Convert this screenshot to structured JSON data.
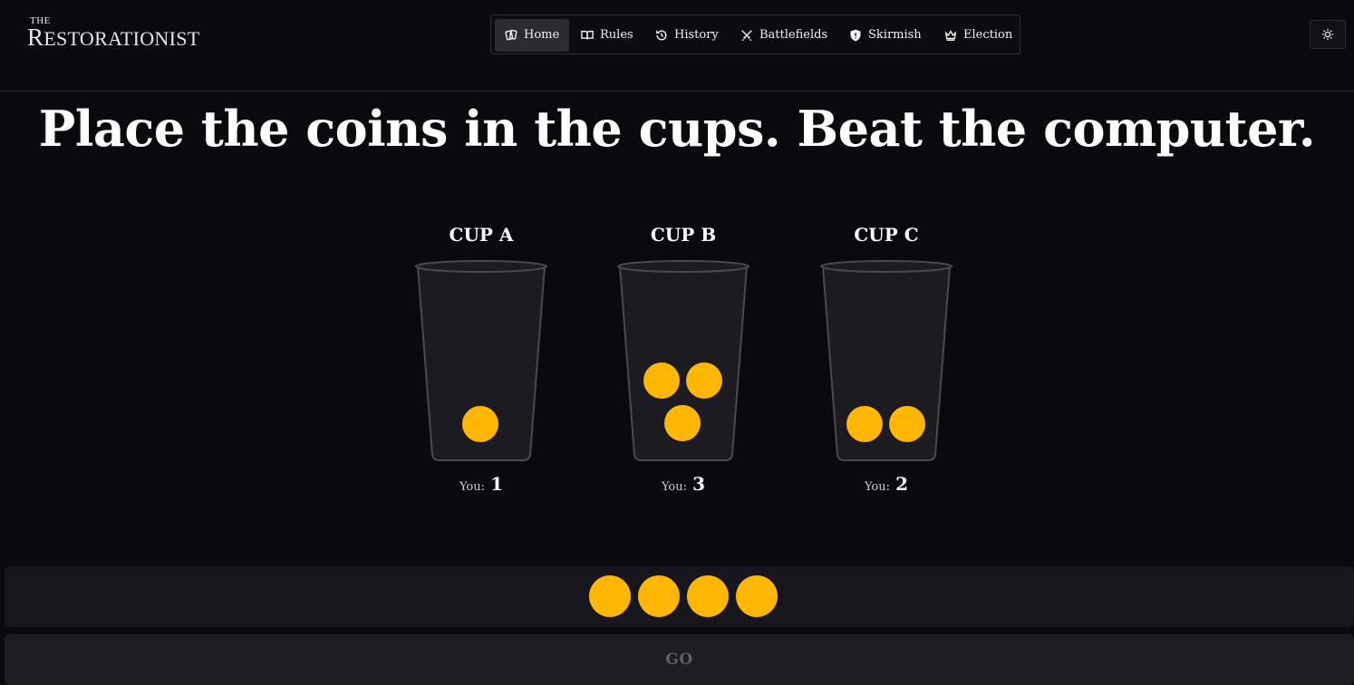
{
  "brand": {
    "the": "THE",
    "first_letter": "R",
    "rest": "ESTORATIONIST"
  },
  "nav": {
    "items": [
      {
        "label": "Home",
        "icon": "cards-icon",
        "active": true
      },
      {
        "label": "Rules",
        "icon": "book-icon"
      },
      {
        "label": "History",
        "icon": "history-icon"
      },
      {
        "label": "Battlefields",
        "icon": "crossed-swords-icon"
      },
      {
        "label": "Skirmish",
        "icon": "shield-icon"
      },
      {
        "label": "Election",
        "icon": "crown-icon"
      }
    ]
  },
  "theme_toggle": {
    "icon": "sun-icon"
  },
  "headline": "Place the coins in the cups. Beat the computer.",
  "cups": [
    {
      "label": "CUP A",
      "you_label": "You:",
      "you_count": "1",
      "coins": 1
    },
    {
      "label": "CUP B",
      "you_label": "You:",
      "you_count": "3",
      "coins": 3
    },
    {
      "label": "CUP C",
      "you_label": "You:",
      "you_count": "2",
      "coins": 2
    }
  ],
  "tray": {
    "coins_remaining": 4
  },
  "go_label": "GO",
  "colors": {
    "coin": "#ffb703",
    "background": "#0a090e",
    "cup_fill": "#1c1b21"
  }
}
